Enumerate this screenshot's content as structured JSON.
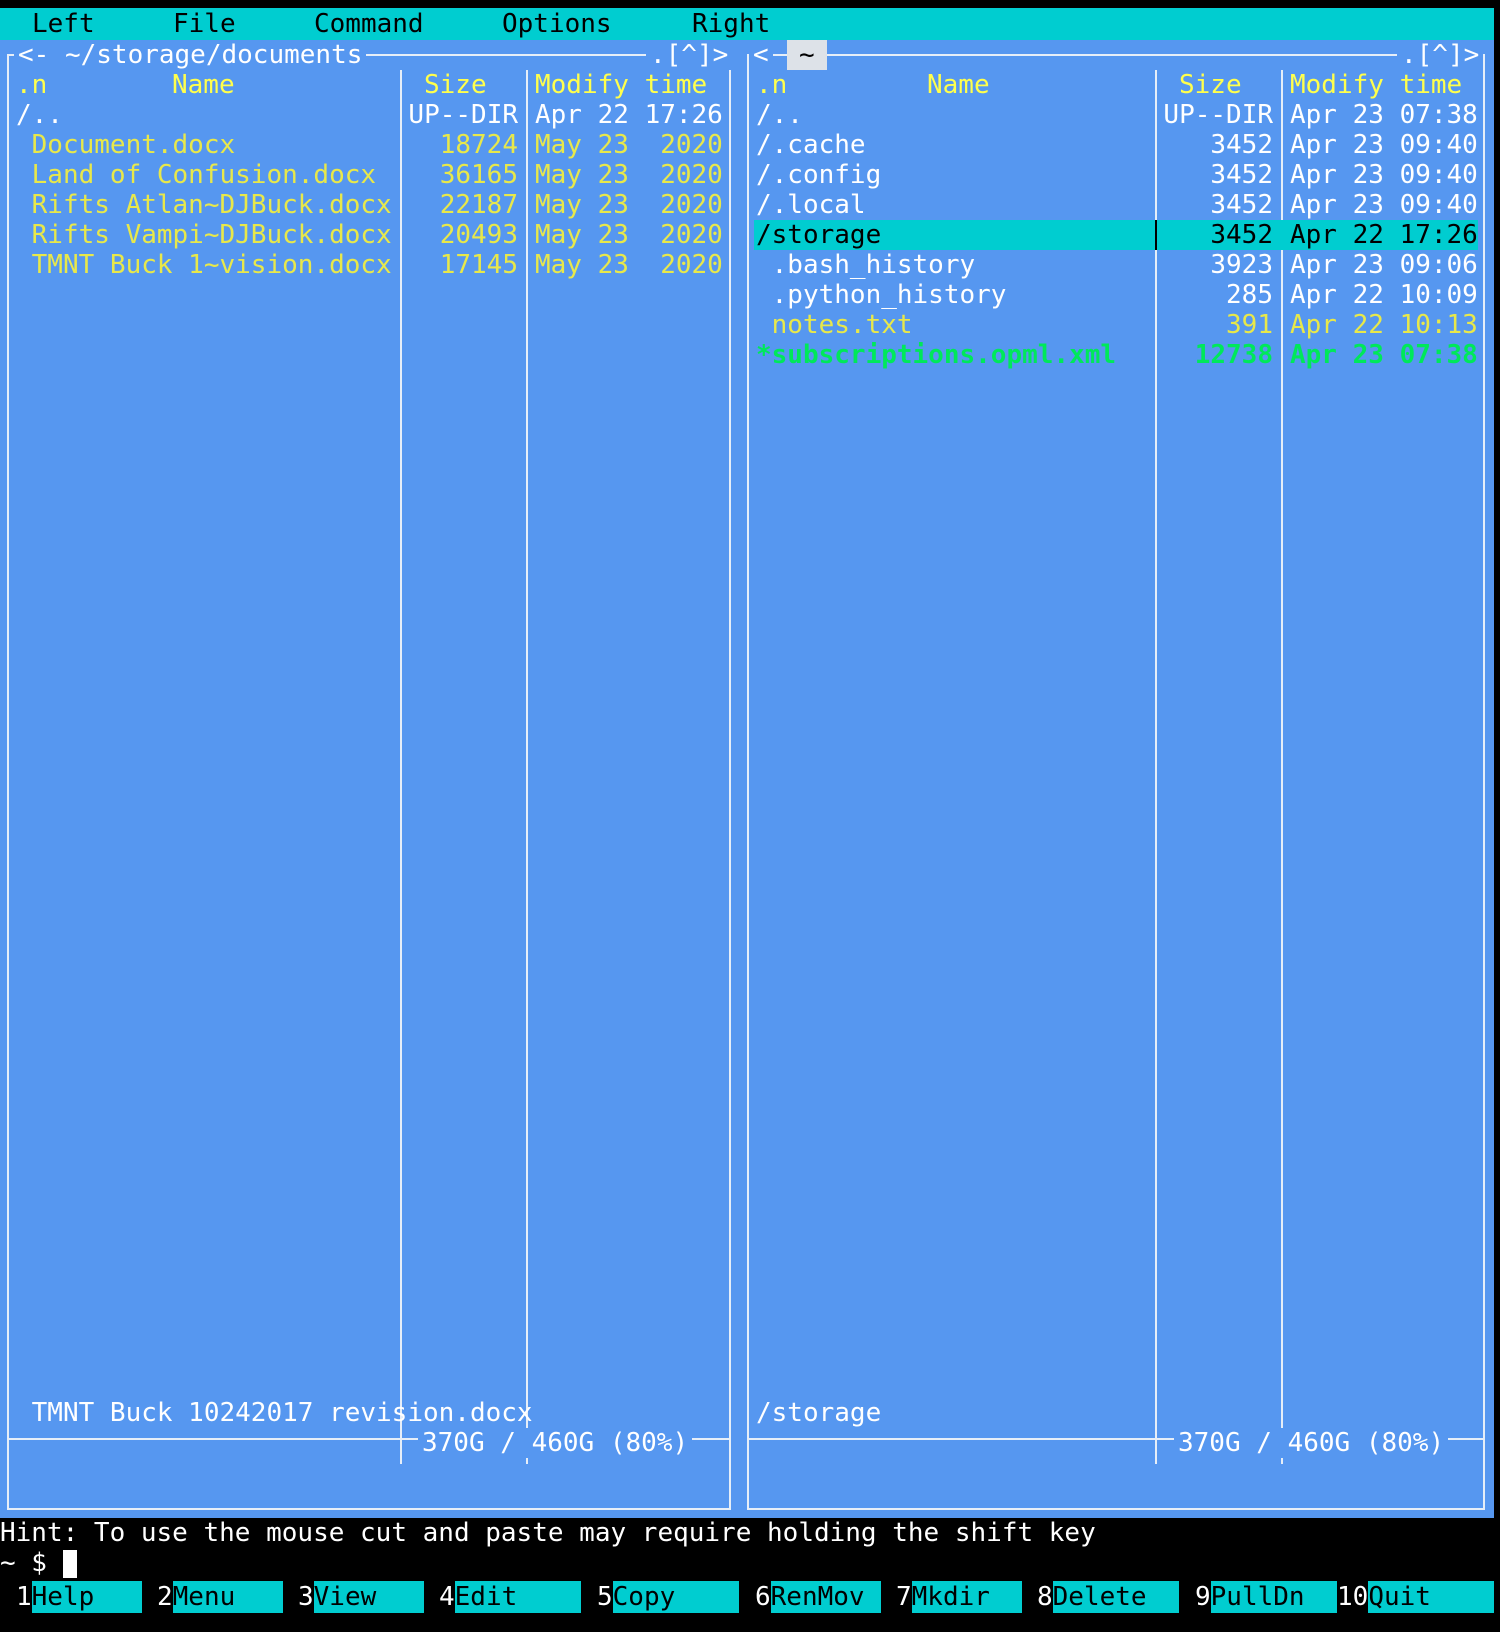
{
  "menubar": [
    "Left",
    "File",
    "Command",
    "Options",
    "Right"
  ],
  "left_panel": {
    "path": "<- ~/storage/documents",
    "corner": ".[^]>",
    "headers": {
      "n": ".n",
      "name": "Name",
      "size": "Size",
      "modify": "Modify time"
    },
    "rows": [
      {
        "name": "/..",
        "size": "UP--DIR",
        "date": "Apr 22 17:26",
        "kind": "dir"
      },
      {
        "name": " Document.docx",
        "size": "18724",
        "date": "May 23  2020",
        "kind": "doc"
      },
      {
        "name": " Land of Confusion.docx",
        "size": "36165",
        "date": "May 23  2020",
        "kind": "doc"
      },
      {
        "name": " Rifts Atlan~DJBuck.docx",
        "size": "22187",
        "date": "May 23  2020",
        "kind": "doc"
      },
      {
        "name": " Rifts Vampi~DJBuck.docx",
        "size": "20493",
        "date": "May 23  2020",
        "kind": "doc"
      },
      {
        "name": " TMNT Buck 1~vision.docx",
        "size": "17145",
        "date": "May 23  2020",
        "kind": "doc"
      }
    ],
    "status": " TMNT Buck 10242017 revision.docx",
    "disk": "370G / 460G (80%)"
  },
  "right_panel": {
    "path_prefix": "<",
    "path": "~",
    "corner": ".[^]>",
    "headers": {
      "n": ".n",
      "name": "Name",
      "size": "Size",
      "modify": "Modify time"
    },
    "rows": [
      {
        "name": "/..",
        "size": "UP--DIR",
        "date": "Apr 23 07:38",
        "kind": "dir"
      },
      {
        "name": "/.cache",
        "size": "3452",
        "date": "Apr 23 09:40",
        "kind": "dir"
      },
      {
        "name": "/.config",
        "size": "3452",
        "date": "Apr 23 09:40",
        "kind": "dir"
      },
      {
        "name": "/.local",
        "size": "3452",
        "date": "Apr 23 09:40",
        "kind": "dir"
      },
      {
        "name": "/storage",
        "size": "3452",
        "date": "Apr 22 17:26",
        "kind": "selected"
      },
      {
        "name": " .bash_history",
        "size": "3923",
        "date": "Apr 23 09:06",
        "kind": "dir"
      },
      {
        "name": " .python_history",
        "size": "285",
        "date": "Apr 22 10:09",
        "kind": "dir"
      },
      {
        "name": " notes.txt",
        "size": "391",
        "date": "Apr 22 10:13",
        "kind": "doc"
      },
      {
        "name": "*subscriptions.opml.xml",
        "size": "12738",
        "date": "Apr 23 07:38",
        "kind": "exe"
      }
    ],
    "status": "/storage",
    "disk": "370G / 460G (80%)"
  },
  "hint": "Hint: To use the mouse cut and paste may require holding the shift key",
  "prompt": "~ $ ",
  "fkeys": [
    {
      "num": "1",
      "label": "Help"
    },
    {
      "num": "2",
      "label": "Menu"
    },
    {
      "num": "3",
      "label": "View"
    },
    {
      "num": "4",
      "label": "Edit"
    },
    {
      "num": "5",
      "label": "Copy"
    },
    {
      "num": "6",
      "label": "RenMov"
    },
    {
      "num": "7",
      "label": "Mkdir"
    },
    {
      "num": "8",
      "label": "Delete"
    },
    {
      "num": "9",
      "label": "PullDn"
    },
    {
      "num": "10",
      "label": "Quit"
    }
  ],
  "colors": {
    "panel": "#5697f0",
    "accent": "#00cdd0",
    "header": "#ffff4c",
    "doc": "#e8e84a",
    "exe": "#00e85a"
  }
}
